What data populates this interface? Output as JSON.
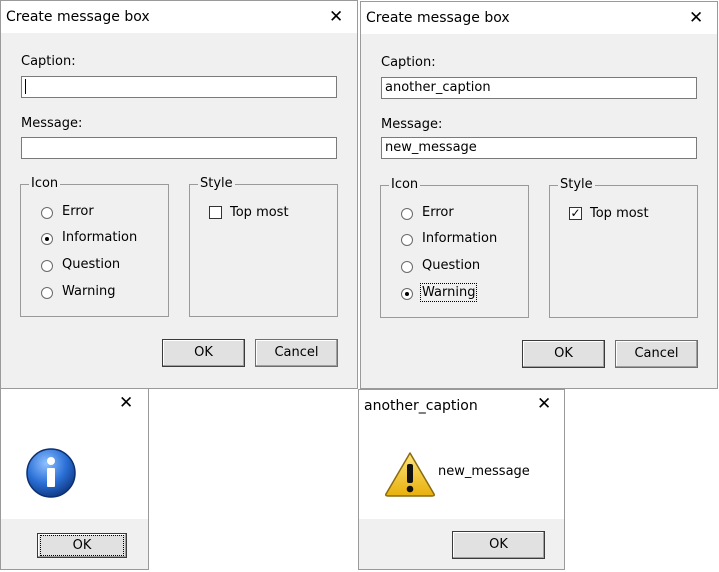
{
  "dialog_left": {
    "title": "Create message box",
    "close": "✕",
    "caption_label": "Caption:",
    "caption_value": "",
    "message_label": "Message:",
    "message_value": "",
    "icon_group": "Icon",
    "style_group": "Style",
    "options": [
      "Error",
      "Information",
      "Question",
      "Warning"
    ],
    "selected_option": "Information",
    "topmost_label": "Top most",
    "topmost_checked": false,
    "ok": "OK",
    "cancel": "Cancel"
  },
  "dialog_right": {
    "title": "Create message box",
    "close": "✕",
    "caption_label": "Caption:",
    "caption_value": "another_caption",
    "message_label": "Message:",
    "message_value": "new_message",
    "icon_group": "Icon",
    "style_group": "Style",
    "options": [
      "Error",
      "Information",
      "Question",
      "Warning"
    ],
    "selected_option": "Warning",
    "topmost_label": "Top most",
    "topmost_checked": true,
    "ok": "OK",
    "cancel": "Cancel"
  },
  "msgbox_left": {
    "title": "",
    "close": "✕",
    "icon": "information-icon",
    "message": "",
    "ok": "OK"
  },
  "msgbox_right": {
    "title": "another_caption",
    "close": "✕",
    "icon": "warning-icon",
    "message": "new_message",
    "ok": "OK"
  },
  "colors": {
    "info_blue": "#1e5fbf",
    "warning_yellow": "#f2c418"
  }
}
